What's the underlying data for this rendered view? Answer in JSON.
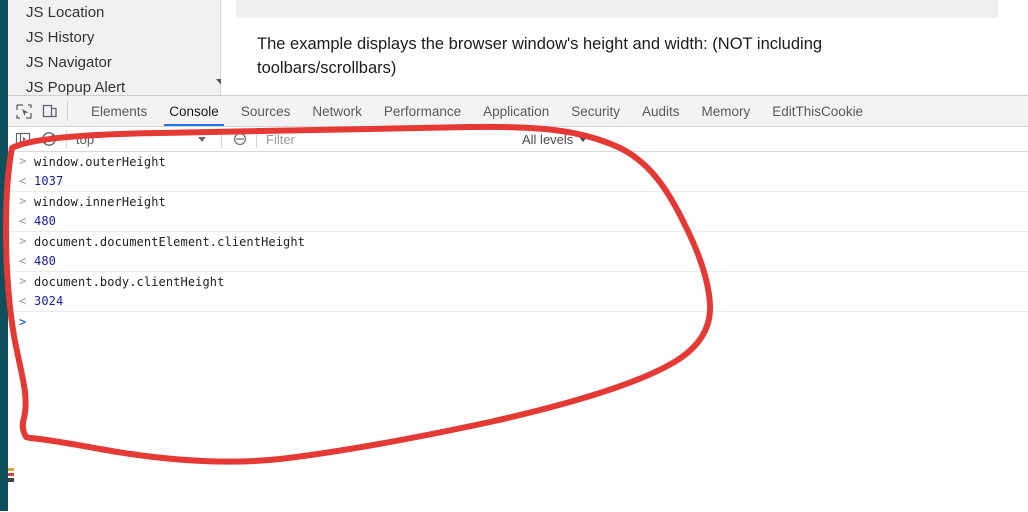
{
  "page": {
    "sidebar": {
      "items": [
        {
          "label": "JS Location"
        },
        {
          "label": "JS History"
        },
        {
          "label": "JS Navigator"
        },
        {
          "label": "JS Popup Alert"
        }
      ],
      "scroll_down_icon": "chevron-down-icon"
    },
    "content": {
      "paragraph": "The example displays the browser window's height and width: (NOT including toolbars/scrollbars)"
    }
  },
  "devtools": {
    "toolbar_icons": [
      {
        "name": "inspect-element-icon"
      },
      {
        "name": "device-toolbar-icon"
      }
    ],
    "tabs": [
      {
        "label": "Elements",
        "active": false
      },
      {
        "label": "Console",
        "active": true
      },
      {
        "label": "Sources",
        "active": false
      },
      {
        "label": "Network",
        "active": false
      },
      {
        "label": "Performance",
        "active": false
      },
      {
        "label": "Application",
        "active": false
      },
      {
        "label": "Security",
        "active": false
      },
      {
        "label": "Audits",
        "active": false
      },
      {
        "label": "Memory",
        "active": false
      },
      {
        "label": "EditThisCookie",
        "active": false
      }
    ],
    "active_tab": "Console",
    "accent_color": "#1a73e8",
    "filterbar": {
      "sidebar_toggle_icon": "console-sidebar-toggle-icon",
      "clear_console_icon": "clear-console-icon",
      "context": "top",
      "context_caret_icon": "chevron-down-icon",
      "settings_icon": "eye-slash-icon",
      "filter_placeholder": "Filter",
      "log_level": "All levels",
      "log_level_caret_icon": "chevron-down-icon"
    },
    "console": {
      "input_marker": ">",
      "output_marker": "<",
      "prompt_marker": ">",
      "value_color": "#1a1aa6",
      "entries": [
        {
          "input": "window.outerHeight",
          "output": "1037"
        },
        {
          "input": "window.innerHeight",
          "output": "480"
        },
        {
          "input": "document.documentElement.clientHeight",
          "output": "480"
        },
        {
          "input": "document.body.clientHeight",
          "output": "3024"
        }
      ]
    }
  },
  "annotation": {
    "type": "freehand-ellipse",
    "color": "#e53935",
    "stroke_width": 6
  }
}
